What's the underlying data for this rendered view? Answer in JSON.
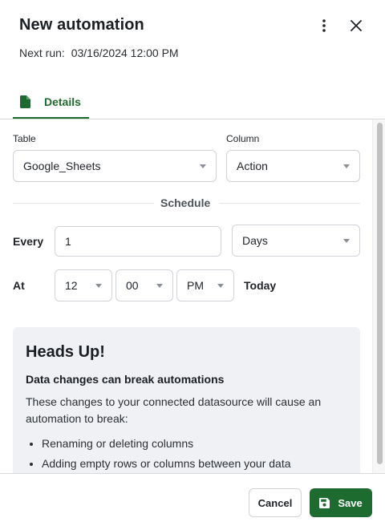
{
  "header": {
    "title": "New automation",
    "next_run_label": "Next run:",
    "next_run_value": "03/16/2024 12:00 PM",
    "more_icon": "kebab-vertical-icon",
    "close_icon": "close-icon"
  },
  "tabs": [
    {
      "label": "Details",
      "icon": "document-icon",
      "active": true
    }
  ],
  "form": {
    "table_label": "Table",
    "table_value": "Google_Sheets",
    "column_label": "Column",
    "column_value": "Action",
    "schedule_heading": "Schedule",
    "every_label": "Every",
    "every_value": "1",
    "unit_value": "Days",
    "at_label": "At",
    "hour_value": "12",
    "minute_value": "00",
    "ampm_value": "PM",
    "day_value": "Today"
  },
  "alert": {
    "title": "Heads Up!",
    "subtitle": "Data changes can break automations",
    "body": "These changes to your connected datasource will cause an automation to break:",
    "items": [
      "Renaming or deleting columns",
      "Adding empty rows or columns between your data"
    ]
  },
  "footer": {
    "cancel_label": "Cancel",
    "save_label": "Save",
    "save_icon": "floppy-disk-icon"
  },
  "colors": {
    "accent": "#1e6b2f",
    "alert_bg": "#f0f1f4",
    "border": "#cfd3d7"
  }
}
